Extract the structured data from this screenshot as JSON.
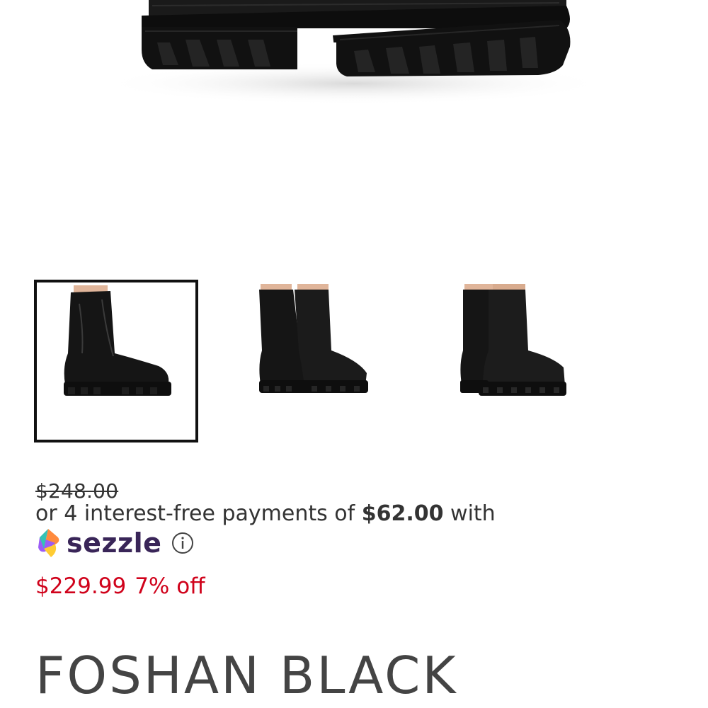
{
  "gallery": {
    "main_image": "black-chunky-ankle-boot-image",
    "thumbnails": [
      {
        "name": "boot-side-view",
        "selected": true
      },
      {
        "name": "boots-front-pair-view",
        "selected": false
      },
      {
        "name": "boots-back-angle-view",
        "selected": false
      }
    ]
  },
  "pricing": {
    "original_price": "$248.00",
    "installment_prefix": "or 4 interest-free payments of",
    "installment_amount": "$62.00",
    "installment_suffix": "with",
    "provider": "sezzle",
    "sale_price": "$229.99",
    "discount": "7% off"
  },
  "product": {
    "title": "FOSHAN BLACK"
  },
  "colors": {
    "sale": "#d0021b",
    "sezzle_brand": "#392558",
    "selected_border": "#111111"
  }
}
